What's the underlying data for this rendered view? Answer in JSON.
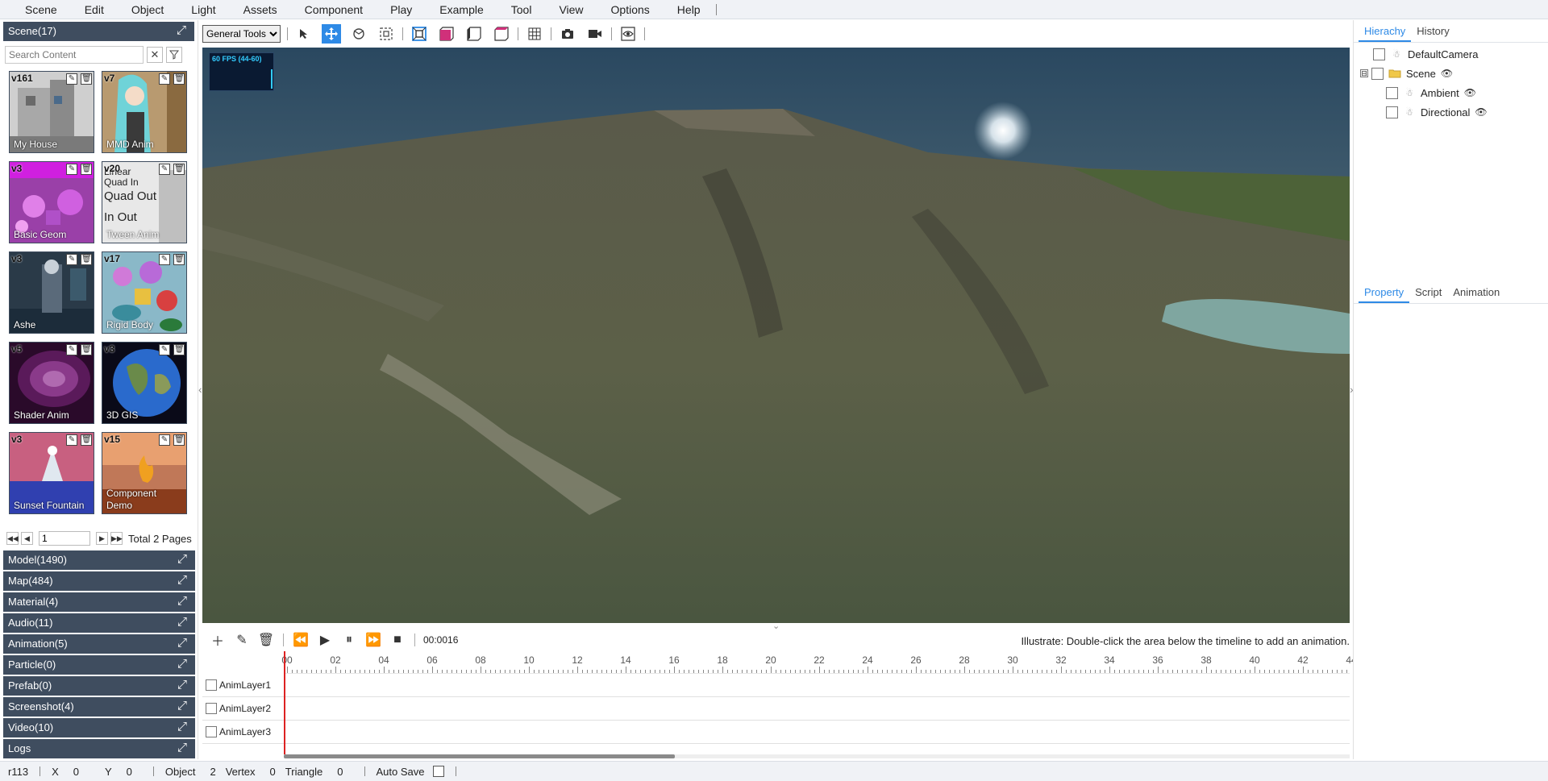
{
  "menu": [
    "Scene",
    "Edit",
    "Object",
    "Light",
    "Assets",
    "Component",
    "Play",
    "Example",
    "Tool",
    "View",
    "Options",
    "Help"
  ],
  "left": {
    "scene_header": "Scene(17)",
    "search_placeholder": "Search Content",
    "cards": [
      {
        "version": "v161",
        "name": "My House",
        "colors": [
          "#cfcfcf",
          "#7a7a7a"
        ]
      },
      {
        "version": "v7",
        "name": "MMD Anim",
        "colors": [
          "#6fd3d8",
          "#3a3a3a"
        ]
      },
      {
        "version": "v3",
        "name": "Basic Geom",
        "colors": [
          "#c040c8",
          "#7c2a9a"
        ]
      },
      {
        "version": "v20",
        "name": "Tween Anim",
        "colors": [
          "#e8e8e8",
          "#bfbfbf"
        ]
      },
      {
        "version": "v3",
        "name": "Ashe",
        "colors": [
          "#3c5a6c",
          "#1c2c3a"
        ]
      },
      {
        "version": "v17",
        "name": "Rigid Body",
        "colors": [
          "#b86ad8",
          "#3a8c9c"
        ]
      },
      {
        "version": "v5",
        "name": "Shader Anim",
        "colors": [
          "#7a2a7a",
          "#2a0a2a"
        ]
      },
      {
        "version": "v3",
        "name": "3D GIS",
        "colors": [
          "#2a6acc",
          "#0a0a18"
        ]
      },
      {
        "version": "v3",
        "name": "Sunset Fountain",
        "colors": [
          "#e0e8f0",
          "#3040b0"
        ]
      },
      {
        "version": "v15",
        "name": "Component\nDemo",
        "colors": [
          "#e8a070",
          "#8a3c1c"
        ]
      }
    ],
    "tween_text": [
      "Linear",
      "Quad In",
      "Quad Out",
      "In Out"
    ],
    "pager": {
      "page": "1",
      "total": "Total 2 Pages"
    },
    "categories": [
      "Model(1490)",
      "Map(484)",
      "Material(4)",
      "Audio(11)",
      "Animation(5)",
      "Particle(0)",
      "Prefab(0)",
      "Screenshot(4)",
      "Video(10)",
      "Logs"
    ]
  },
  "toolbar": {
    "tool_select": "General Tools",
    "accent": "#2e8ae6"
  },
  "viewport": {
    "fps": "60 FPS (44-60)"
  },
  "timeline": {
    "time": "00:0016",
    "hint": "Illustrate: Double-click the area below the timeline to add an animation.",
    "ticks": [
      "00",
      "02",
      "04",
      "06",
      "08",
      "10",
      "12",
      "14",
      "16",
      "18",
      "20",
      "22",
      "24",
      "26",
      "28",
      "30",
      "32",
      "34",
      "36",
      "38",
      "40",
      "42",
      "44"
    ],
    "layers": [
      "AnimLayer1",
      "AnimLayer2",
      "AnimLayer3"
    ]
  },
  "right": {
    "top_tabs": [
      "Hierachy",
      "History"
    ],
    "tree": [
      {
        "label": "DefaultCamera",
        "level": 0,
        "toggle": "",
        "icon": "camera-icon",
        "eye": false
      },
      {
        "label": "Scene",
        "level": 0,
        "toggle": "⊟",
        "icon": "folder-icon",
        "eye": true
      },
      {
        "label": "Ambient",
        "level": 1,
        "toggle": "",
        "icon": "light-icon",
        "eye": true
      },
      {
        "label": "Directional",
        "level": 1,
        "toggle": "",
        "icon": "light-icon",
        "eye": true
      }
    ],
    "bottom_tabs": [
      "Property",
      "Script",
      "Animation"
    ]
  },
  "status": {
    "revision": "r113",
    "x_label": "X",
    "x_value": "0",
    "y_label": "Y",
    "y_value": "0",
    "object_label": "Object",
    "object_value": "2",
    "vertex_label": "Vertex",
    "vertex_value": "0",
    "triangle_label": "Triangle",
    "triangle_value": "0",
    "autosave_label": "Auto Save"
  }
}
